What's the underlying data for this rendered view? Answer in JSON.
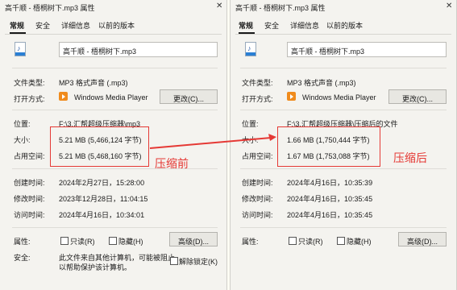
{
  "left": {
    "title": "高千顺 - 梧桐树下.mp3 属性",
    "tabs": [
      "常规",
      "安全",
      "详细信息",
      "以前的版本"
    ],
    "filename": "高千顺 - 梧桐树下.mp3",
    "rows": [
      {
        "label": "文件类型:",
        "value": "MP3 格式声音 (.mp3)"
      },
      {
        "label": "打开方式:",
        "value": "Windows Media Player"
      },
      {
        "label": "位置:",
        "value": "F:\\3.汇帮超级压缩器\\mp3"
      },
      {
        "label": "大小:",
        "value": "5.21 MB (5,466,124 字节)"
      },
      {
        "label": "占用空间:",
        "value": "5.21 MB (5,468,160 字节)"
      },
      {
        "label": "创建时间:",
        "value": "2024年2月27日，15:28:00"
      },
      {
        "label": "修改时间:",
        "value": "2023年12月28日，11:04:15"
      },
      {
        "label": "访问时间:",
        "value": "2024年4月16日，10:34:01"
      }
    ],
    "change_button": "更改(C)...",
    "attributes_label": "属性:",
    "readonly_label": "只读(R)",
    "hidden_label": "隐藏(H)",
    "advanced_button": "高级(D)...",
    "security_label": "安全:",
    "security_text_1": "此文件来自其他计算机，可能被阻止",
    "security_text_2": "以帮助保护该计算机。",
    "unblock_label": "解除锁定(K)",
    "annotation": "压缩前"
  },
  "right": {
    "title": "高千顺 - 梧桐树下.mp3 属性",
    "tabs": [
      "常规",
      "安全",
      "详细信息",
      "以前的版本"
    ],
    "filename": "高千顺 - 梧桐树下.mp3",
    "rows": [
      {
        "label": "文件类型:",
        "value": "MP3 格式声音 (.mp3)"
      },
      {
        "label": "打开方式:",
        "value": "Windows Media Player"
      },
      {
        "label": "位置:",
        "value": "F:\\3.汇帮超级压缩器\\压缩后的文件"
      },
      {
        "label": "大小:",
        "value": "1.66 MB (1,750,444 字节)"
      },
      {
        "label": "占用空间:",
        "value": "1.67 MB (1,753,088 字节)"
      },
      {
        "label": "创建时间:",
        "value": "2024年4月16日，10:35:39"
      },
      {
        "label": "修改时间:",
        "value": "2024年4月16日，10:35:45"
      },
      {
        "label": "访问时间:",
        "value": "2024年4月16日，10:35:45"
      }
    ],
    "change_button": "更改(C)...",
    "attributes_label": "属性:",
    "readonly_label": "只读(R)",
    "hidden_label": "隐藏(H)",
    "advanced_button": "高级(D)...",
    "annotation": "压缩后"
  },
  "colors": {
    "annotation": "#e53935",
    "accent": "#2a7fd4"
  }
}
